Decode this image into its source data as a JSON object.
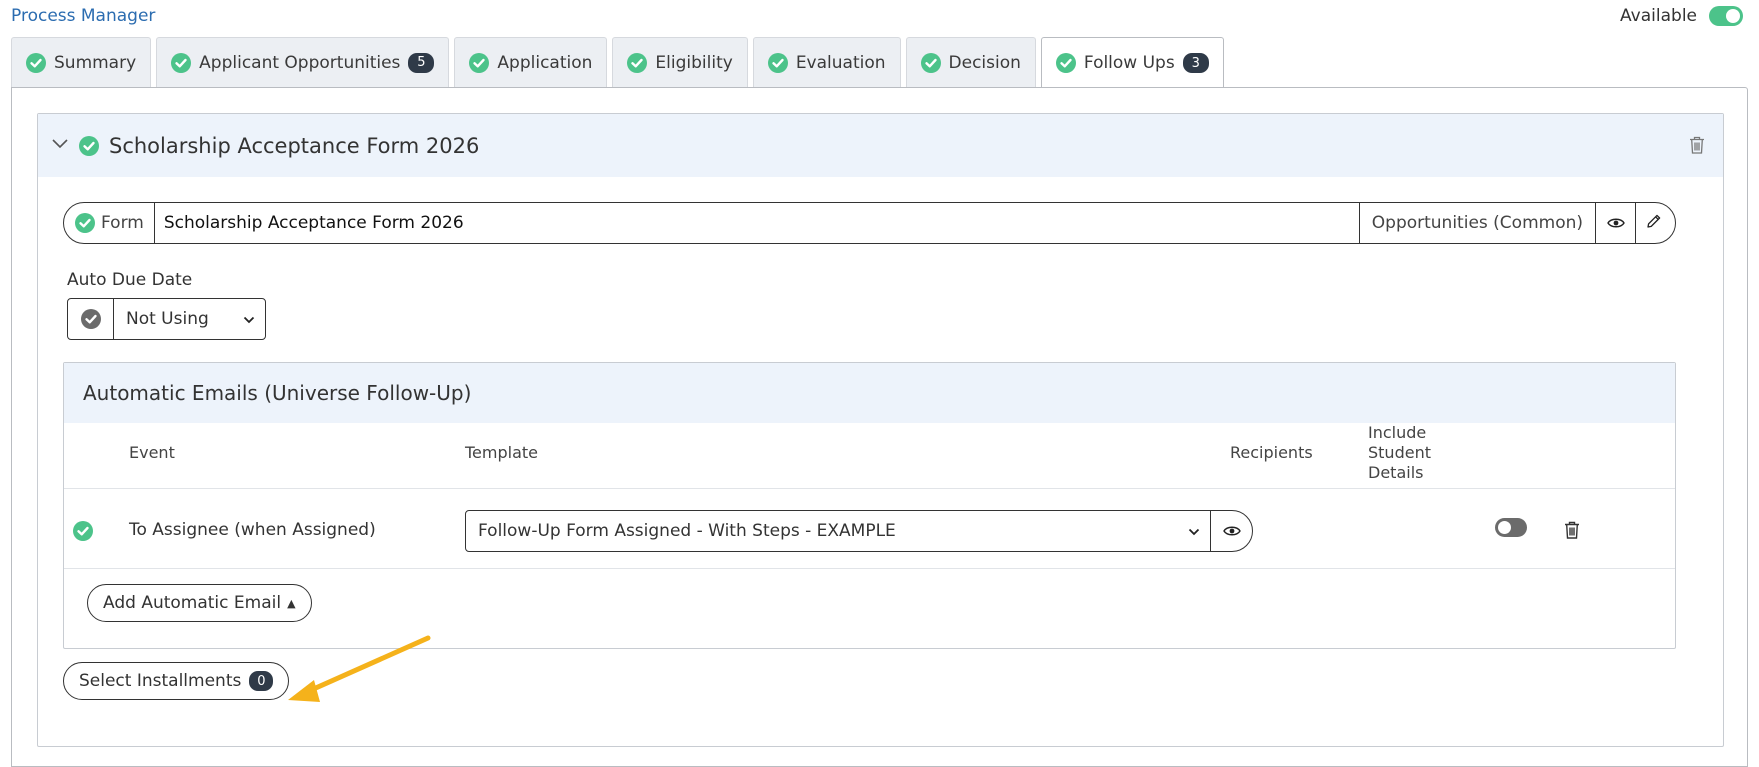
{
  "header": {
    "app_title": "Process Manager",
    "availability_label": "Available",
    "availability_on": true
  },
  "tabs": [
    {
      "label": "Summary"
    },
    {
      "label": "Applicant Opportunities",
      "badge": "5"
    },
    {
      "label": "Application"
    },
    {
      "label": "Eligibility"
    },
    {
      "label": "Evaluation"
    },
    {
      "label": "Decision"
    },
    {
      "label": "Follow Ups",
      "badge": "3",
      "active": true
    }
  ],
  "followup": {
    "title": "Scholarship Acceptance Form 2026",
    "form_label": "Form",
    "form_value": "Scholarship Acceptance Form 2026",
    "form_scope": "Opportunities (Common)",
    "due_date_label": "Auto Due Date",
    "due_date_value": "Not Using"
  },
  "emails": {
    "title": "Automatic Emails (Universe Follow-Up)",
    "columns": {
      "event": "Event",
      "template": "Template",
      "recipients": "Recipients",
      "include_line1": "Include",
      "include_line2": "Student",
      "include_line3": "Details"
    },
    "rows": [
      {
        "event": "To Assignee (when Assigned)",
        "template": "Follow-Up Form Assigned - With Steps - EXAMPLE",
        "include_student_details": false
      }
    ],
    "add_button": "Add Automatic Email"
  },
  "installments": {
    "label": "Select Installments",
    "count": "0"
  },
  "colors": {
    "accent_green": "#4cc38a",
    "link_blue": "#2b6cb0",
    "badge_dark": "#2f3a48",
    "header_bg": "#edf3fb",
    "arrow": "#f5b21b"
  },
  "icons": [
    "check-circle-icon",
    "chevron-down-icon",
    "trash-icon",
    "eye-icon",
    "pencil-icon",
    "caret-up-icon",
    "arrow-annotation"
  ]
}
